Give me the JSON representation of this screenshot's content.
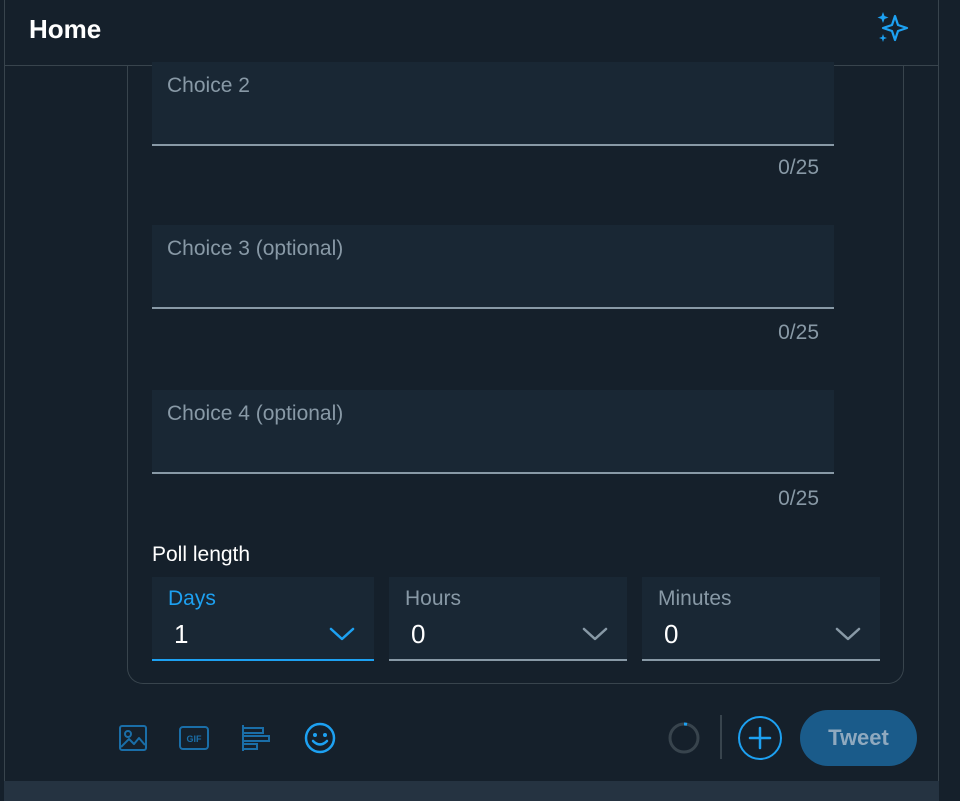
{
  "header": {
    "title": "Home"
  },
  "poll": {
    "choices": [
      {
        "placeholder": "Choice 2",
        "counter": "0/25"
      },
      {
        "placeholder": "Choice 3 (optional)",
        "counter": "0/25"
      },
      {
        "placeholder": "Choice 4 (optional)",
        "counter": "0/25"
      }
    ],
    "length_label": "Poll length",
    "duration": [
      {
        "label": "Days",
        "value": "1"
      },
      {
        "label": "Hours",
        "value": "0"
      },
      {
        "label": "Minutes",
        "value": "0"
      }
    ]
  },
  "toolbar": {
    "icons": [
      "image-icon",
      "gif-icon",
      "poll-icon",
      "emoji-icon"
    ],
    "tweet_label": "Tweet"
  },
  "colors": {
    "background": "#15202b",
    "field": "#192734",
    "accent": "#1da1f2",
    "muted": "#8899a6",
    "border": "#38444d",
    "tweet_button": "#1a5b8a"
  }
}
